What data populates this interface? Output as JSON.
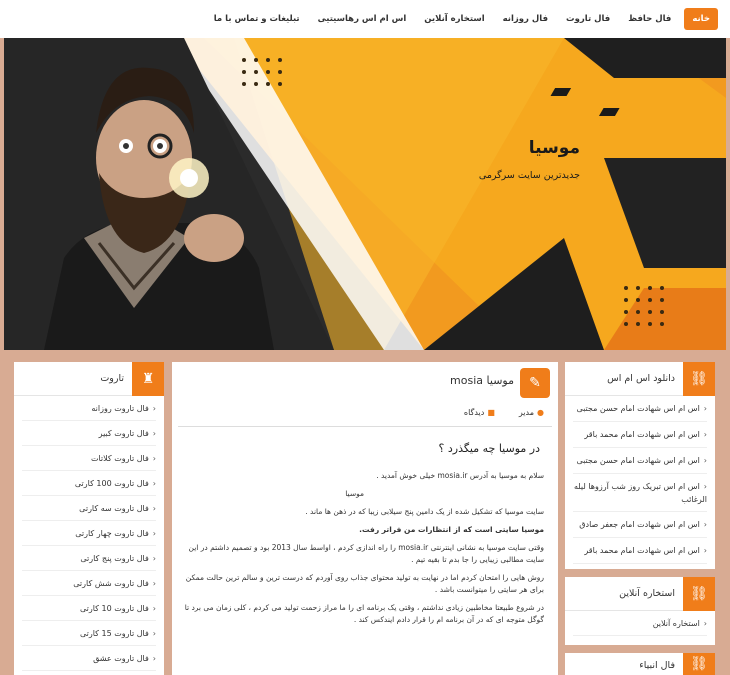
{
  "nav": {
    "items": [
      "خانه",
      "فال حافظ",
      "فال تاروت",
      "فال روزانه",
      "استخاره آنلاین",
      "اس ام اس رهاسیتیی",
      "تبلیغات و تماس با ما"
    ]
  },
  "hero": {
    "title": "موسیا",
    "tagline": "جدیدترین سایت سرگرمی"
  },
  "tarot_widget": {
    "title": "تاروت",
    "items": [
      "فال تاروت روزانه",
      "فال تاروت کبیر",
      "فال تاروت کلاتات",
      "فال تاروت 100 کارتی",
      "فال تاروت سه کارتی",
      "فال تاروت چهار کارتی",
      "فال تاروت پنج کارتی",
      "فال تاروت شش کارتی",
      "فال تاروت 10 کارتی",
      "فال تاروت 15 کارتی",
      "فال تاروت عشق"
    ]
  },
  "main": {
    "header_title": "موسیا mosia",
    "author": "مدیر",
    "comments": "دیدگاه",
    "article_title": "در موسیا چه میگذرد ؟",
    "paragraphs": [
      "سلام به موسیا به آدرس mosia.ir خیلی خوش آمدید .",
      "موسیا",
      "سایت موسیا که تشکیل شده از یک دامین پنج سیلابی زیبا که در ذهن ها ماند .",
      "موسیا سایتی است که از انتظارات من فراتر رفت.",
      "وقتی سایت موسیا به نشانی اینترنتی mosia.ir را راه اندازی کردم ، اواسط سال 2013 بود و تصمیم داشتم در این سایت مطالبی زیبایی را جا بدم تا بقیه تیم .",
      "روش هایی را امتحان کردم اما در نهایت به تولید محتوای جذاب روی آوردم که درست ترین و سالم ترین حالت ممکن برای هر سایتی را میتوانست باشد .",
      "در شروع طبیعتا مخاطبین زیادی نداشتم ، وقتی یک برنامه ای را ما مراز زحمت تولید می کردم ، کلی زمان می برد تا گوگل متوجه ای که در آن برنامه ام را قرار دادم ایندکس کند ."
    ]
  },
  "sms_widget": {
    "title": "دانلود اس ام اس",
    "items": [
      "اس ام اس شهادت امام حسن مجتبی",
      "اس ام اس شهادت امام محمد باقر",
      "اس ام اس شهادت امام حسن مجتبی",
      "اس ام اس تبریک روز شب آرزوها لیله الرغائب",
      "اس ام اس شهادت امام جعفر صادق",
      "اس ام اس شهادت امام محمد باقر"
    ]
  },
  "istikhara_widget": {
    "title": "استخاره آنلاین",
    "items": [
      "استخاره آنلاین"
    ]
  },
  "third_widget": {
    "title": "فال انبیاء"
  },
  "colors": {
    "accent": "#f07d1a",
    "page_bg": "#d8ab93"
  }
}
